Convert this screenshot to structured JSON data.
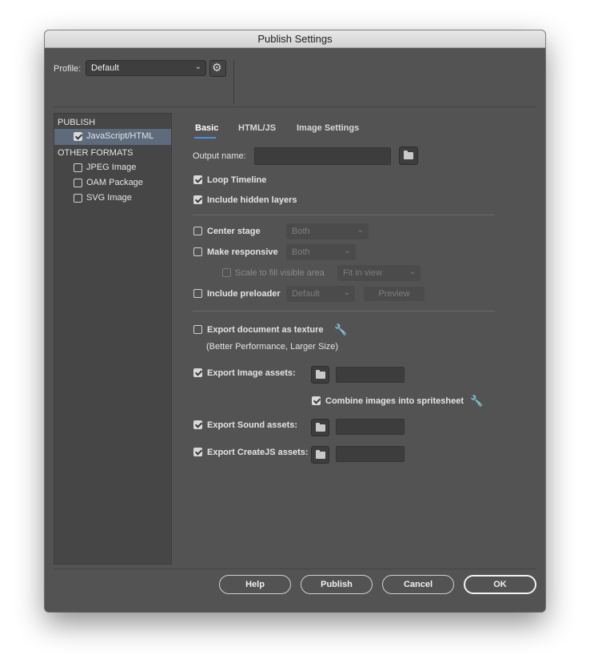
{
  "window": {
    "title": "Publish Settings"
  },
  "profile": {
    "label": "Profile:",
    "value": "Default",
    "chevron_icon": "chevron-down-icon",
    "settings_icon": "gear-icon"
  },
  "sidebar": {
    "publish_header": "PUBLISH",
    "other_header": "OTHER FORMATS",
    "items": [
      {
        "label": "JavaScript/HTML",
        "checked": true,
        "selected": true
      },
      {
        "label": "JPEG Image",
        "checked": false
      },
      {
        "label": "OAM Package",
        "checked": false
      },
      {
        "label": "SVG Image",
        "checked": false
      }
    ]
  },
  "tabs": [
    {
      "label": "Basic",
      "active": true
    },
    {
      "label": "HTML/JS",
      "active": false
    },
    {
      "label": "Image Settings",
      "active": false
    }
  ],
  "basic": {
    "output_name": {
      "label": "Output name:",
      "value": ""
    },
    "loop_timeline": {
      "label": "Loop Timeline",
      "checked": true
    },
    "include_hidden_layers": {
      "label": "Include hidden layers",
      "checked": true
    },
    "center_stage": {
      "label": "Center stage",
      "checked": false,
      "option": "Both"
    },
    "make_responsive": {
      "label": "Make responsive",
      "checked": false,
      "option": "Both"
    },
    "scale_to_fill": {
      "label": "Scale to fill visible area",
      "checked": false,
      "option": "Fit in view"
    },
    "include_preloader": {
      "label": "Include preloader",
      "checked": false,
      "option": "Default",
      "preview_label": "Preview"
    },
    "export_texture": {
      "label": "Export document as texture",
      "checked": false,
      "note": "(Better Performance, Larger Size)"
    },
    "export_image_assets": {
      "label": "Export Image assets:",
      "checked": true,
      "path": ""
    },
    "combine_spritesheet": {
      "label": "Combine images into spritesheet",
      "checked": true
    },
    "export_sound_assets": {
      "label": "Export Sound assets:",
      "checked": true,
      "path": ""
    },
    "export_createjs_assets": {
      "label": "Export CreateJS assets:",
      "checked": true,
      "path": ""
    }
  },
  "footer": {
    "help": "Help",
    "publish": "Publish",
    "cancel": "Cancel",
    "ok": "OK"
  },
  "colors": {
    "window_bg": "#535353",
    "sidebar_selection": "#5d6b7d",
    "tab_accent": "#4a90e2"
  }
}
